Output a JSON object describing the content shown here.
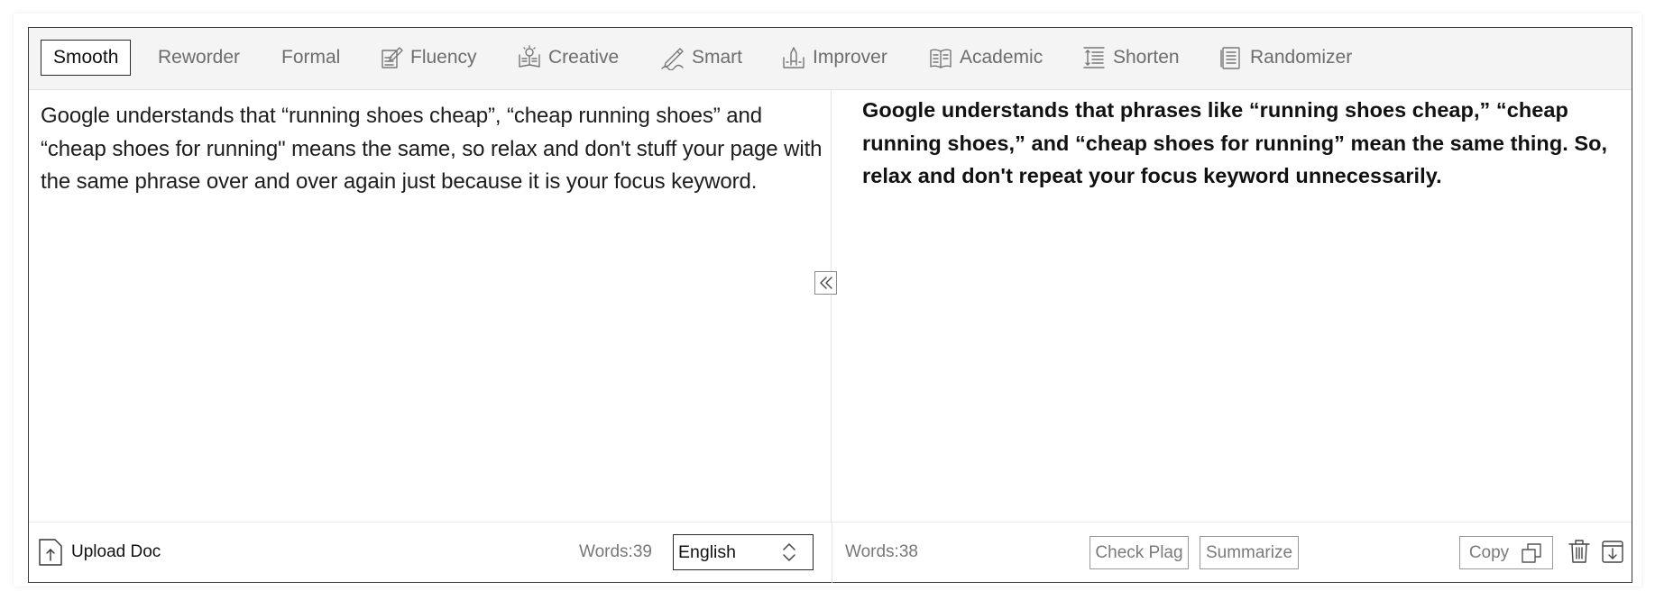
{
  "modes": [
    {
      "label": "Smooth",
      "icon": "none",
      "active": true
    },
    {
      "label": "Reworder",
      "icon": "none",
      "active": false
    },
    {
      "label": "Formal",
      "icon": "none",
      "active": false
    },
    {
      "label": "Fluency",
      "icon": "pen-document-icon",
      "active": false
    },
    {
      "label": "Creative",
      "icon": "lightbulb-book-icon",
      "active": false
    },
    {
      "label": "Smart",
      "icon": "pen-sign-icon",
      "active": false
    },
    {
      "label": "Improver",
      "icon": "pencil-up-icon",
      "active": false
    },
    {
      "label": "Academic",
      "icon": "open-book-icon",
      "active": false
    },
    {
      "label": "Shorten",
      "icon": "shorten-lines-icon",
      "active": false
    },
    {
      "label": "Randomizer",
      "icon": "document-lines-icon",
      "active": false
    }
  ],
  "input": {
    "text": "Google understands that “running shoes cheap”, “cheap running shoes” and “cheap shoes for running\" means the same, so relax and don't stuff your page with the same phrase over and over again just because it is your focus keyword."
  },
  "output": {
    "text": "Google understands that phrases like “running shoes cheap,” “cheap running shoes,” and “cheap shoes for running” mean the same thing. So, relax and don't repeat your focus keyword unnecessarily."
  },
  "footer_left": {
    "upload_label": "Upload Doc",
    "word_count": "Words:39",
    "language": "English"
  },
  "footer_right": {
    "word_count": "Words:38",
    "check_plag_label": "Check Plag",
    "summarize_label": "Summarize",
    "copy_label": "Copy"
  }
}
